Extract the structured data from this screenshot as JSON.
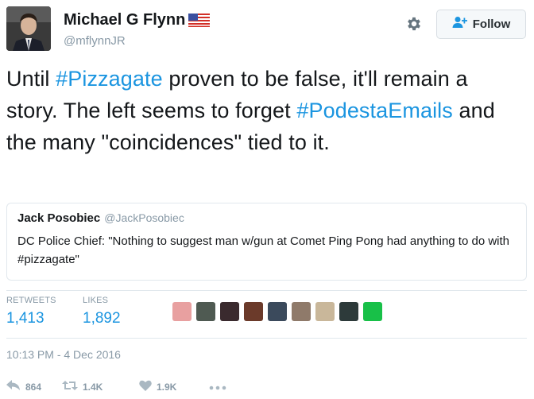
{
  "author": {
    "display_name": "Michael G Flynn",
    "handle": "@mflynnJR",
    "flag_icon": "us-flag-icon"
  },
  "follow_button": {
    "label": "Follow",
    "icon": "add-user-icon"
  },
  "settings": {
    "icon": "gear-icon"
  },
  "tweet": {
    "segments": [
      {
        "text": "Until ",
        "hashtag": false
      },
      {
        "text": "#Pizzagate",
        "hashtag": true
      },
      {
        "text": " proven to be false, it'll remain a story. The left seems to forget ",
        "hashtag": false
      },
      {
        "text": "#PodestaEmails",
        "hashtag": true
      },
      {
        "text": " and the many \"coincidences\" tied to it.",
        "hashtag": false
      }
    ]
  },
  "quoted_tweet": {
    "name": "Jack Posobiec",
    "handle": "@JackPosobiec",
    "text": "DC Police Chief: \"Nothing to suggest man w/gun at Comet Ping Pong had anything to do with #pizzagate\""
  },
  "stats": {
    "retweets_label": "RETWEETS",
    "retweets_value": "1,413",
    "likes_label": "LIKES",
    "likes_value": "1,892"
  },
  "likers": [
    {
      "name": "liker-avatar-1",
      "color": "#e8a0a0"
    },
    {
      "name": "liker-avatar-2",
      "color": "#4f5a52"
    },
    {
      "name": "liker-avatar-3",
      "color": "#3a2a2e"
    },
    {
      "name": "liker-avatar-4",
      "color": "#6b3a2a"
    },
    {
      "name": "liker-avatar-5",
      "color": "#3b4a5c"
    },
    {
      "name": "liker-avatar-6",
      "color": "#8f7a6a"
    },
    {
      "name": "liker-avatar-7",
      "color": "#c9b79a"
    },
    {
      "name": "liker-avatar-8",
      "color": "#2d3a3a"
    },
    {
      "name": "liker-avatar-9",
      "color": "#18c048"
    }
  ],
  "timestamp": "10:13 PM - 4 Dec 2016",
  "actions": {
    "reply_count": "864",
    "retweet_count": "1.4K",
    "like_count": "1.9K"
  },
  "colors": {
    "link": "#1b95e0",
    "secondary_text": "#8899a6",
    "border": "#e1e8ed"
  }
}
